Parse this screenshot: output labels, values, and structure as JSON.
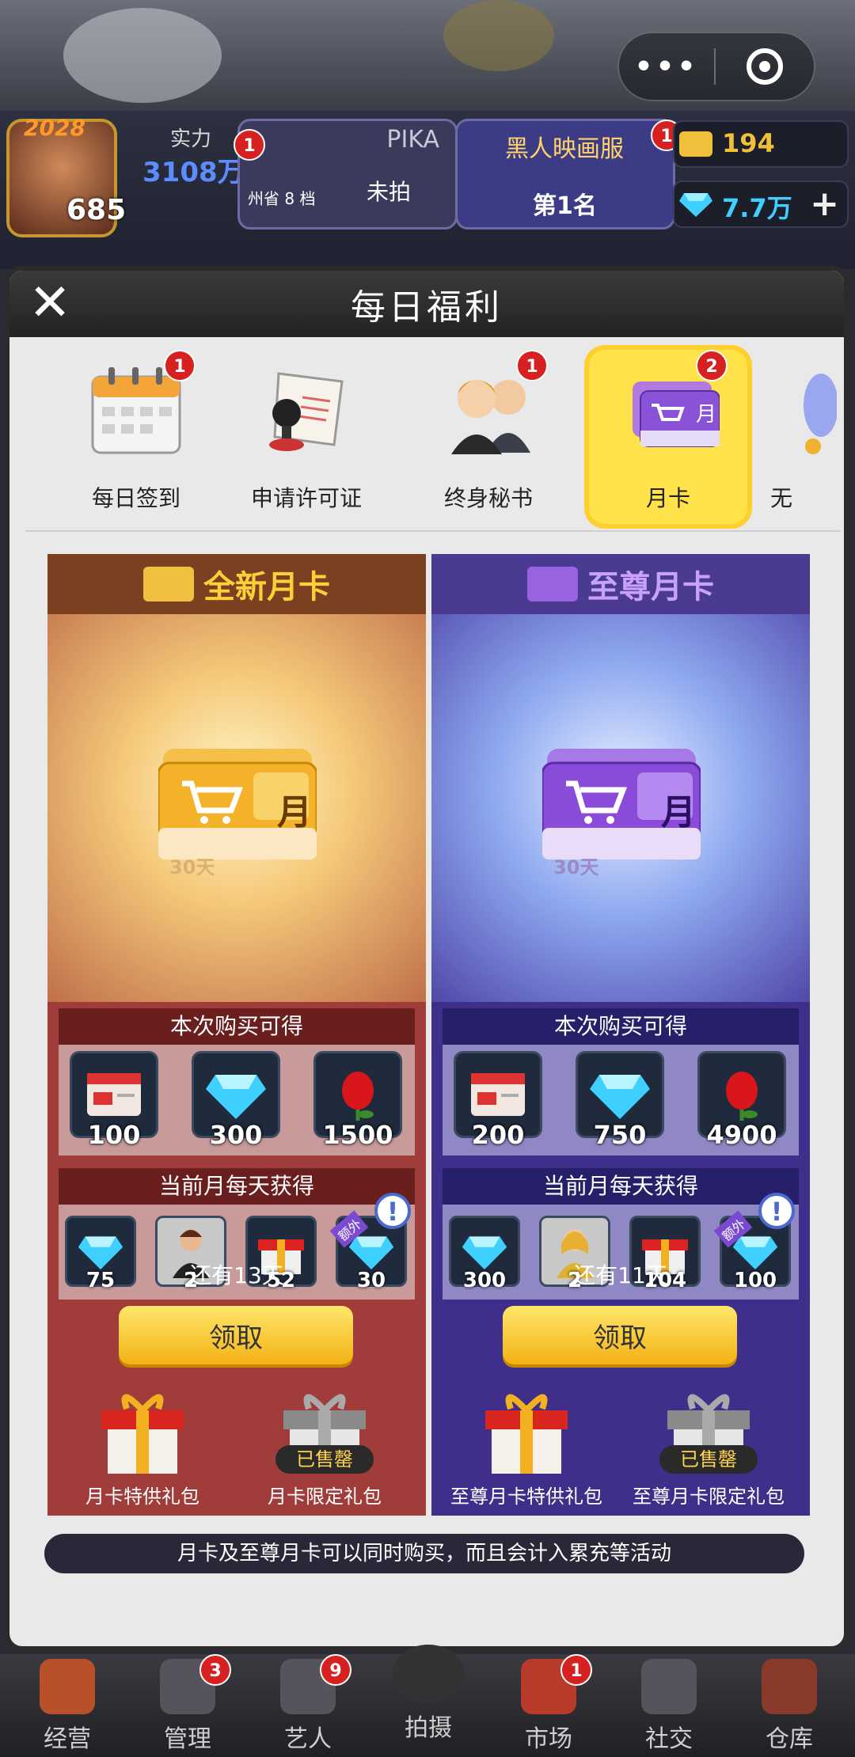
{
  "hud": {
    "year": "2028",
    "avatar_level": "685",
    "power_label": "实力",
    "power_value": "3108万",
    "card1_title": "PIKA",
    "card1_sub": "州省 8 档",
    "card1_status": "未拍",
    "card1_badge": "1",
    "card2_title": "黑人映画服",
    "card2_rank": "第1名",
    "card2_badge": "1",
    "res_gold": "194",
    "res_diamond": "7.7万",
    "res_gold_color": "#f0c03a",
    "res_diamond_color": "#3fd0ff"
  },
  "capsule": {
    "more": "•••"
  },
  "panel": {
    "title": "每日福利",
    "close": "✕",
    "tabs": [
      {
        "label": "每日签到",
        "badge": "1",
        "icon": "calendar-icon"
      },
      {
        "label": "申请许可证",
        "badge": "",
        "icon": "certificate-icon"
      },
      {
        "label": "终身秘书",
        "badge": "1",
        "icon": "secretary-icon"
      },
      {
        "label": "月卡",
        "badge": "2",
        "icon": "month-card-icon"
      },
      {
        "label": "无",
        "badge": "",
        "icon": "figure-icon"
      }
    ]
  },
  "left": {
    "name": "全新月卡",
    "card_text": "月",
    "card_days": "30天",
    "buy_title": "本次购买可得",
    "buy_items": [
      {
        "icon": "ticket-icon",
        "count": "100"
      },
      {
        "icon": "diamond-icon",
        "count": "300"
      },
      {
        "icon": "rose-icon",
        "count": "1500"
      }
    ],
    "daily_title": "当前月每天获得",
    "daily_items": [
      {
        "icon": "diamond-icon",
        "count": "75"
      },
      {
        "icon": "actor-card-icon",
        "count": "2"
      },
      {
        "icon": "gift-box-icon",
        "count": "52"
      },
      {
        "icon": "diamond-icon",
        "count": "30"
      }
    ],
    "extra_tag": "额外",
    "days_left": "还有13天",
    "claim": "领取",
    "gift1": "月卡特供礼包",
    "gift2": "月卡限定礼包",
    "sold_out": "已售罄",
    "accent": "#ffcf3a"
  },
  "right": {
    "name": "至尊月卡",
    "card_text": "月",
    "card_days": "30天",
    "buy_title": "本次购买可得",
    "buy_items": [
      {
        "icon": "ticket-icon",
        "count": "200"
      },
      {
        "icon": "diamond-icon",
        "count": "750"
      },
      {
        "icon": "rose-icon",
        "count": "4900"
      }
    ],
    "daily_title": "当前月每天获得",
    "daily_items": [
      {
        "icon": "diamond-icon",
        "count": "300"
      },
      {
        "icon": "actress-card-icon",
        "count": "2"
      },
      {
        "icon": "gift-box-icon",
        "count": "104"
      },
      {
        "icon": "diamond-icon",
        "count": "100"
      }
    ],
    "extra_tag": "额外",
    "days_left": "还有11天",
    "claim": "领取",
    "gift1": "至尊月卡特供礼包",
    "gift2": "至尊月卡限定礼包",
    "sold_out": "已售罄",
    "accent": "#c8a0ff"
  },
  "note": "月卡及至尊月卡可以同时购买，而且会计入累充等活动",
  "bottom_nav": [
    {
      "label": "经营",
      "badge": ""
    },
    {
      "label": "管理",
      "badge": "3"
    },
    {
      "label": "艺人",
      "badge": "9"
    },
    {
      "label": "拍摄",
      "badge": ""
    },
    {
      "label": "市场",
      "badge": "1"
    },
    {
      "label": "社交",
      "badge": ""
    },
    {
      "label": "仓库",
      "badge": ""
    }
  ]
}
